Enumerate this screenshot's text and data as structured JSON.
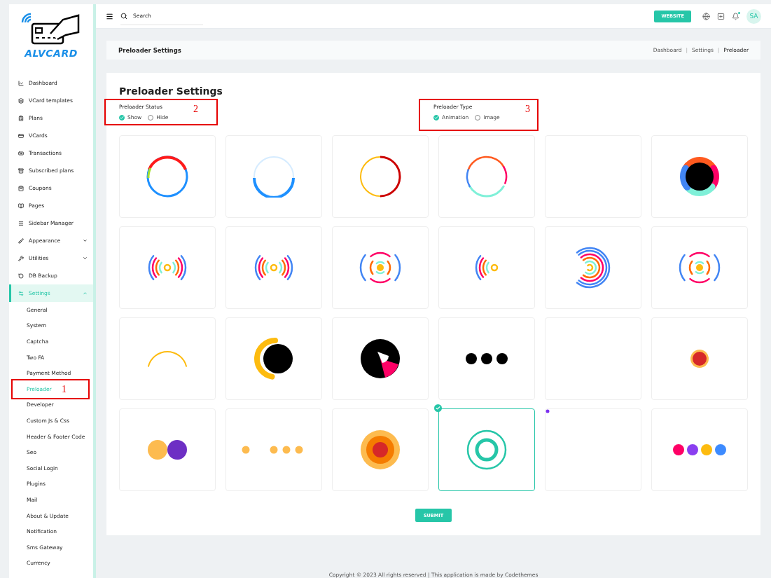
{
  "brand": {
    "name": "ALVCARD"
  },
  "sidebar": {
    "items": [
      {
        "label": "Dashboard",
        "selected": false
      },
      {
        "label": "VCard templates",
        "selected": false
      },
      {
        "label": "Plans",
        "selected": false
      },
      {
        "label": "VCards",
        "selected": false
      },
      {
        "label": "Transactions",
        "selected": false
      },
      {
        "label": "Subscribed plans",
        "selected": false
      },
      {
        "label": "Coupons",
        "selected": false
      },
      {
        "label": "Pages",
        "selected": false
      },
      {
        "label": "Sidebar Manager",
        "selected": false
      },
      {
        "label": "Appearance",
        "selected": false,
        "expanded": false
      },
      {
        "label": "Utilities",
        "selected": false,
        "expanded": false
      },
      {
        "label": "DB Backup",
        "selected": false
      },
      {
        "label": "Settings",
        "selected": true,
        "expanded": true,
        "children": [
          {
            "label": "General",
            "selected": false
          },
          {
            "label": "System",
            "selected": false
          },
          {
            "label": "Captcha",
            "selected": false
          },
          {
            "label": "Two FA",
            "selected": false
          },
          {
            "label": "Payment Method",
            "selected": false
          },
          {
            "label": "Preloader",
            "selected": true,
            "callout": "1"
          },
          {
            "label": "Developer",
            "selected": false
          },
          {
            "label": "Custom Js & Css",
            "selected": false
          },
          {
            "label": "Header & Footer Code",
            "selected": false
          },
          {
            "label": "Seo",
            "selected": false
          },
          {
            "label": "Social Login",
            "selected": false
          },
          {
            "label": "Plugins",
            "selected": false
          },
          {
            "label": "Mail",
            "selected": false
          },
          {
            "label": "About & Update",
            "selected": false
          },
          {
            "label": "Notification",
            "selected": false
          },
          {
            "label": "Sms Gateway",
            "selected": false
          },
          {
            "label": "Currency",
            "selected": false
          }
        ]
      }
    ]
  },
  "topbar": {
    "search_placeholder": "Search",
    "website_button": "WEBSITE",
    "avatar": "SA",
    "notification": true
  },
  "breadcrumb_bar": {
    "title": "Preloader Settings",
    "crumbs": [
      "Dashboard",
      "Settings",
      "Preloader"
    ],
    "separator": "|"
  },
  "card": {
    "title": "Preloader Settings",
    "groups": [
      {
        "label": "Preloader Status",
        "callout": "2",
        "options": [
          {
            "label": "Show",
            "selected": true
          },
          {
            "label": "Hide",
            "selected": false
          }
        ]
      },
      {
        "label": "Preloader Type",
        "callout": "3",
        "options": [
          {
            "label": "Animation",
            "selected": true
          },
          {
            "label": "Image",
            "selected": false
          }
        ]
      }
    ],
    "tiles": [
      {
        "kind": "ring-gradient",
        "selected": false
      },
      {
        "kind": "ring-glow",
        "selected": false
      },
      {
        "kind": "ring-split",
        "selected": false
      },
      {
        "kind": "ring-multi",
        "selected": false
      },
      {
        "kind": "blank",
        "selected": false
      },
      {
        "kind": "donut",
        "selected": false
      },
      {
        "kind": "waves",
        "selected": false
      },
      {
        "kind": "waves",
        "selected": false
      },
      {
        "kind": "target",
        "selected": false
      },
      {
        "kind": "waves-left",
        "selected": false
      },
      {
        "kind": "arcs-right",
        "selected": false
      },
      {
        "kind": "target",
        "selected": false
      },
      {
        "kind": "arc-top",
        "selected": false
      },
      {
        "kind": "eclipse",
        "selected": false
      },
      {
        "kind": "pie",
        "selected": false
      },
      {
        "kind": "dots-black",
        "selected": false
      },
      {
        "kind": "blank",
        "selected": false
      },
      {
        "kind": "dot-red",
        "selected": false
      },
      {
        "kind": "two-dots",
        "selected": false
      },
      {
        "kind": "dots-yellow",
        "selected": false
      },
      {
        "kind": "concentric",
        "selected": false
      },
      {
        "kind": "rings-teal",
        "selected": true
      },
      {
        "kind": "dot-corner",
        "selected": false
      },
      {
        "kind": "dots-color",
        "selected": false
      }
    ],
    "submit": "SUBMIT"
  },
  "footer": "Copyright © 2023 All rights reserved | This application is made by Codethemes"
}
